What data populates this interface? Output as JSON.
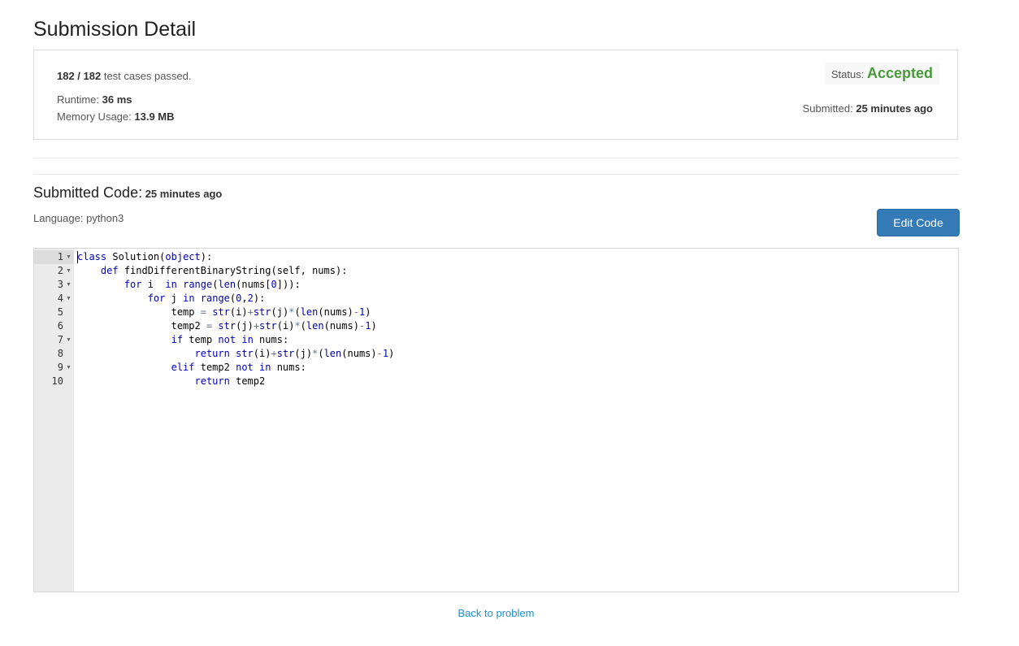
{
  "page": {
    "title": "Submission Detail"
  },
  "summary": {
    "tests_count": "182 / 182",
    "tests_suffix": " test cases passed.",
    "runtime_label": "Runtime: ",
    "runtime_value": "36 ms",
    "memory_label": "Memory Usage: ",
    "memory_value": "13.9 MB",
    "status_label": "Status: ",
    "status_value": "Accepted",
    "submitted_label": "Submitted: ",
    "submitted_value": "25 minutes ago"
  },
  "code_section": {
    "heading": "Submitted Code:",
    "time": " 25 minutes ago",
    "language_label": "Language: ",
    "language_value": "python3",
    "edit_button": "Edit Code"
  },
  "editor": {
    "line_numbers": [
      "1",
      "2",
      "3",
      "4",
      "5",
      "6",
      "7",
      "8",
      "9",
      "10"
    ],
    "foldable": [
      true,
      true,
      true,
      true,
      false,
      false,
      true,
      false,
      true,
      false
    ],
    "lines": [
      "class Solution(object):",
      "    def findDifferentBinaryString(self, nums):",
      "        for i  in range(len(nums[0])):",
      "            for j in range(0,2):",
      "                temp = str(i)+str(j)*(len(nums)-1)",
      "                temp2 = str(j)+str(i)*(len(nums)-1)",
      "                if temp not in nums:",
      "                    return str(i)+str(j)*(len(nums)-1)",
      "                elif temp2 not in nums:",
      "                    return temp2"
    ]
  },
  "footer": {
    "back_link": "Back to problem"
  },
  "colors": {
    "accepted": "#4a9a3c",
    "button": "#337ab7",
    "link": "#1a90d9"
  },
  "icons": {
    "fold": "fold-arrow-icon"
  }
}
